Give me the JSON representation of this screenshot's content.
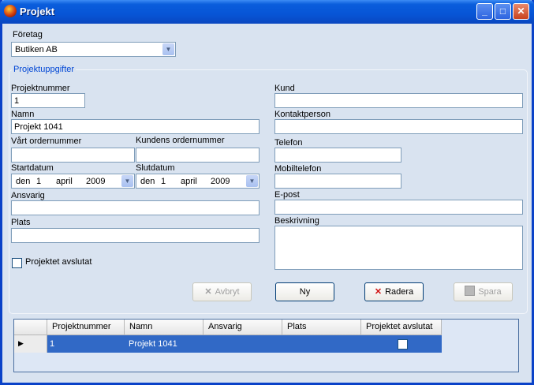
{
  "window": {
    "title": "Projekt"
  },
  "titlebar_buttons": {
    "minimize": "_",
    "maximize": "□",
    "close": "✕"
  },
  "company": {
    "label": "Företag",
    "value": "Butiken AB"
  },
  "group": {
    "title": "Projektuppgifter"
  },
  "fields": {
    "project_number": {
      "label": "Projektnummer",
      "value": "1"
    },
    "name": {
      "label": "Namn",
      "value": "Projekt 1041"
    },
    "our_order": {
      "label": "Vårt ordernummer",
      "value": ""
    },
    "customer_order": {
      "label": "Kundens ordernummer",
      "value": ""
    },
    "start_date": {
      "label": "Startdatum",
      "day_word": "den",
      "day": "1",
      "month": "april",
      "year": "2009"
    },
    "end_date": {
      "label": "Slutdatum",
      "day_word": "den",
      "day": "1",
      "month": "april",
      "year": "2009"
    },
    "responsible": {
      "label": "Ansvarig",
      "value": ""
    },
    "place": {
      "label": "Plats",
      "value": ""
    },
    "customer": {
      "label": "Kund",
      "value": ""
    },
    "contact": {
      "label": "Kontaktperson",
      "value": ""
    },
    "phone": {
      "label": "Telefon",
      "value": ""
    },
    "mobile": {
      "label": "Mobiltelefon",
      "value": ""
    },
    "email": {
      "label": "E-post",
      "value": ""
    },
    "description": {
      "label": "Beskrivning",
      "value": ""
    },
    "closed": {
      "label": "Projektet avslutat",
      "checked": false
    }
  },
  "buttons": {
    "cancel": "Avbryt",
    "new": "Ny",
    "delete": "Radera",
    "save": "Spara"
  },
  "grid": {
    "columns": [
      "Projektnummer",
      "Namn",
      "Ansvarig",
      "Plats",
      "Projektet avslutat"
    ],
    "rows": [
      {
        "project_number": "1",
        "name": "Projekt 1041",
        "responsible": "",
        "place": "",
        "closed": false
      }
    ]
  },
  "colors": {
    "titlebar": "#0755d6",
    "form_bg": "#d9e3f0",
    "group_title": "#0046d5",
    "selection": "#3169c6"
  }
}
